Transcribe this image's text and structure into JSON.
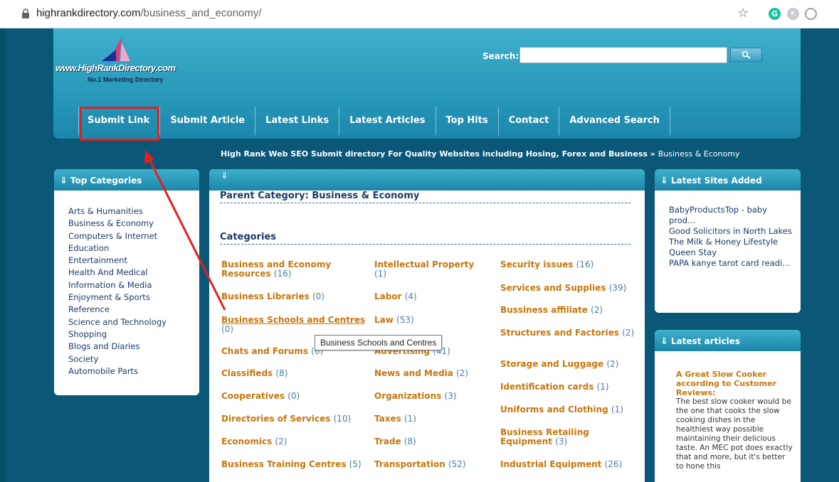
{
  "browser": {
    "url_host": "highrankdirectory.com",
    "url_path": "/business_and_economy/",
    "ext_g": "G",
    "ext_k": "K"
  },
  "header": {
    "logo_text": "www.HighRankDirectory.com",
    "logo_sub": "No.1 Marketing Directory",
    "search_label": "Search:",
    "search_value": ""
  },
  "nav": [
    {
      "label": "Submit Link"
    },
    {
      "label": "Submit Article"
    },
    {
      "label": "Latest Links"
    },
    {
      "label": "Latest Articles"
    },
    {
      "label": "Top Hits"
    },
    {
      "label": "Contact"
    },
    {
      "label": "Advanced Search"
    }
  ],
  "breadcrumb": {
    "root": "High Rank Web SEO Submit directory For Quality Websites including Hosing, Forex and Business",
    "sep": "»",
    "current": "Business & Economy"
  },
  "left": {
    "title": "Top Categories",
    "items": [
      "Arts & Humanities",
      "Business & Economy",
      "Computers & Internet",
      "Education",
      "Entertainment",
      "Health And Medical",
      "Information & Media",
      "Enjoyment & Sports",
      "Reference",
      "Science and Technology",
      "Shopping",
      "Blogs and Diaries",
      "Society",
      "Automobile Parts"
    ]
  },
  "main": {
    "parent": "Parent Category: Business & Economy",
    "categories_title": "Categories",
    "col1": [
      {
        "name": "Business and Economy Resources",
        "count": "(16)"
      },
      {
        "name": "Business Libraries",
        "count": "(0)"
      },
      {
        "name": "Business Schools and Centres",
        "count": "(0)"
      },
      {
        "name": "Chats and Forums",
        "count": "(6)"
      },
      {
        "name": "Classifieds",
        "count": "(8)"
      },
      {
        "name": "Cooperatives",
        "count": "(0)"
      },
      {
        "name": "Directories of Services",
        "count": "(10)"
      },
      {
        "name": "Economics",
        "count": "(2)"
      },
      {
        "name": "Business Training Centres",
        "count": "(5)"
      }
    ],
    "col2": [
      {
        "name": "Intellectual Property",
        "count": "(1)"
      },
      {
        "name": "Labor",
        "count": "(4)"
      },
      {
        "name": "Law",
        "count": "(53)"
      },
      {
        "name": "Advertising",
        "count": "(41)"
      },
      {
        "name": "News and Media",
        "count": "(2)"
      },
      {
        "name": "Organizations",
        "count": "(3)"
      },
      {
        "name": "Taxes",
        "count": "(1)"
      },
      {
        "name": "Trade",
        "count": "(8)"
      },
      {
        "name": "Transportation",
        "count": "(52)"
      }
    ],
    "col3": [
      {
        "name": "Security issues",
        "count": "(16)"
      },
      {
        "name": "Services and Supplies",
        "count": "(39)"
      },
      {
        "name": "Bussiness affiliate",
        "count": "(2)"
      },
      {
        "name": "Structures and Factories",
        "count": "(2)"
      },
      {
        "name": "Storage and Luggage",
        "count": "(2)"
      },
      {
        "name": "Identification cards",
        "count": "(1)"
      },
      {
        "name": "Uniforms and Clothing",
        "count": "(1)"
      },
      {
        "name": "Business Retailing Equipment",
        "count": "(3)"
      },
      {
        "name": "Industrial Equipment",
        "count": "(26)"
      }
    ],
    "tooltip": "Business Schools and Centres"
  },
  "right": {
    "sites_title": "Latest Sites Added",
    "sites": [
      "BabyProductsTop - baby prod...",
      "Good Solicitors in North Lakes",
      "The Milk & Honey Lifestyle",
      "Queen Stay",
      "PAPA kanye tarot card readi..."
    ],
    "articles_title": "Latest articles",
    "article_title": "A Great Slow Cooker according to Customer Reviews:",
    "article_body": "The best slow cooker would be the one that cooks the slow cooking dishes in the healthiest way possible maintaining their delicious taste. An MEC pot does exactly that and more, but it's better to hone this"
  },
  "colors": {
    "accent": "#c4770e",
    "highlight": "#e22020",
    "header": "#2495b7"
  }
}
